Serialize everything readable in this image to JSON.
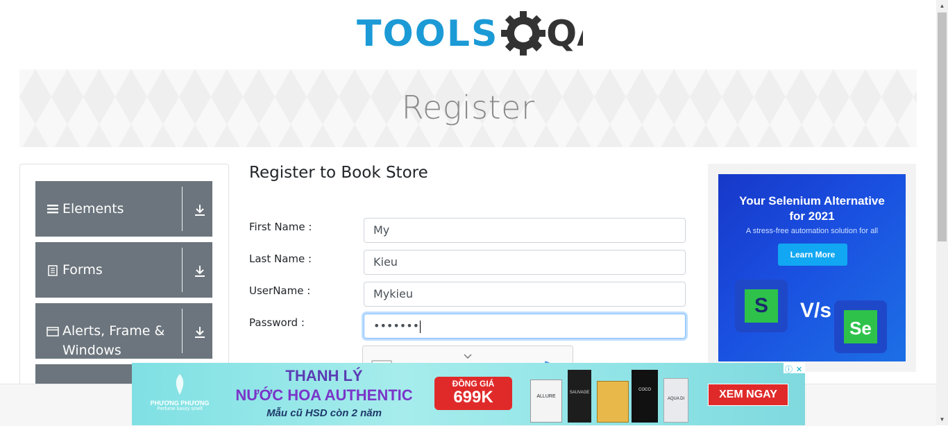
{
  "logo": {
    "text_left": "TOOLS",
    "text_right": "QA"
  },
  "banner": {
    "title": "Register"
  },
  "nav": {
    "groups": [
      {
        "label": "Elements",
        "icon": "hamburger-icon"
      },
      {
        "label": "Forms",
        "icon": "document-icon"
      },
      {
        "label": "Alerts, Frame & Windows",
        "icon": "window-icon"
      }
    ]
  },
  "form": {
    "title": "Register to Book Store",
    "first_name": {
      "label": "First Name :",
      "value": "My"
    },
    "last_name": {
      "label": "Last Name :",
      "value": "Kieu"
    },
    "username": {
      "label": "UserName :",
      "value": "Mykieu"
    },
    "password": {
      "label": "Password :",
      "value": "•••••••"
    }
  },
  "right_ad": {
    "headline_line1": "Your Selenium Alternative",
    "headline_line2": "for 2021",
    "subline": "A stress-free automation solution for all",
    "cta": "Learn More",
    "vs": "V/s",
    "left_logo": "S",
    "right_logo": "Se"
  },
  "bottom_ad": {
    "brand": "PHƯƠNG PHƯƠNG",
    "brand_tagline": "Perfume luxury smell",
    "line1": "THANH LÝ",
    "line2": "NƯỚC HOA AUTHENTIC",
    "line3": "Mẫu cũ HSD còn 2 năm",
    "price_label": "ĐỒNG GIÁ",
    "price": "699K",
    "cta": "XEM NGAY",
    "bottles": [
      "ALLURE",
      "SAUVAGE",
      "",
      "COCO",
      "AQUA DI"
    ]
  },
  "colors": {
    "logo_blue": "#1b9ad6",
    "logo_dark": "#333333",
    "nav_gray": "#6c757d",
    "ad_blue": "#1a4fe0",
    "cta_red": "#e02a2a"
  }
}
